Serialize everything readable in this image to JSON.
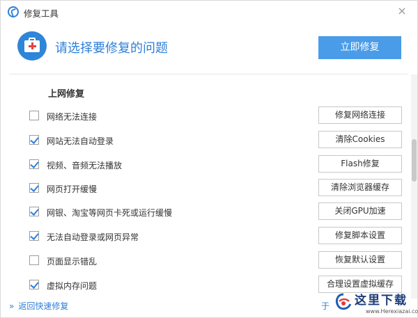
{
  "window": {
    "title": "修复工具",
    "close_glyph": "×"
  },
  "header": {
    "icon": "first-aid-kit-icon",
    "heading": "请选择要修复的问题",
    "repair_now_label": "立即修复"
  },
  "section": {
    "title": "上网修复"
  },
  "rows": [
    {
      "label": "网络无法连接",
      "checked": false,
      "action": "修复网络连接"
    },
    {
      "label": "网站无法自动登录",
      "checked": true,
      "action": "清除Cookies"
    },
    {
      "label": "视频、音频无法播放",
      "checked": true,
      "action": "Flash修复"
    },
    {
      "label": "网页打开缓慢",
      "checked": true,
      "action": "清除浏览器缓存"
    },
    {
      "label": "网银、淘宝等网页卡死或运行缓慢",
      "checked": true,
      "action": "关闭GPU加速"
    },
    {
      "label": "无法自动登录或网页异常",
      "checked": true,
      "action": "修复脚本设置"
    },
    {
      "label": "页面显示错乱",
      "checked": false,
      "action": "恢复默认设置"
    },
    {
      "label": "虚拟内存问题",
      "checked": true,
      "action": "合理设置虚拟缓存"
    }
  ],
  "footer": {
    "back_chevron": "»",
    "back_label": "返回快速修复",
    "right_partial": "于"
  },
  "watermark": {
    "text": "这里下载",
    "sub": "www.Herexiazai.com"
  },
  "colors": {
    "accent": "#2f7fd8",
    "primary_button": "#4a9ce8"
  }
}
